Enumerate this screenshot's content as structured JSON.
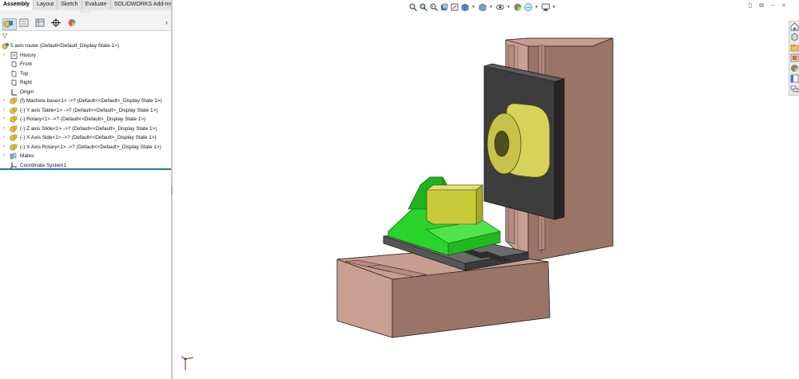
{
  "tabs": [
    "Assembly",
    "Layout",
    "Sketch",
    "Evaluate",
    "SOLIDWORKS Add-Ins"
  ],
  "manager": {
    "icons": [
      "feature-manager-icon",
      "property-manager-icon",
      "configuration-manager-icon",
      "dimxpert-manager-icon",
      "display-manager-icon"
    ],
    "expand_glyph": "›",
    "filter_glyph": "▽"
  },
  "tree": {
    "root": "5 axis router  (Default<Default_Display State-1>)",
    "items": [
      {
        "label": "History",
        "icon": "history-icon",
        "expand": true
      },
      {
        "label": "Front",
        "icon": "plane-icon",
        "expand": false
      },
      {
        "label": "Top",
        "icon": "plane-icon",
        "expand": false
      },
      {
        "label": "Right",
        "icon": "plane-icon",
        "expand": false
      },
      {
        "label": "Origin",
        "icon": "origin-icon",
        "expand": false
      },
      {
        "label": "(f) Machine base<1> ->? (Default<<Default>_Display State 1>)",
        "icon": "part-icon",
        "expand": true
      },
      {
        "label": "(-) Y axis Table<1> ->? (Default<<Default>_Display State 1>)",
        "icon": "part-icon",
        "expand": true
      },
      {
        "label": "(-) Rotary<1> ->? (Default<<Default>_Display State 1>)",
        "icon": "part-icon",
        "expand": true
      },
      {
        "label": "(-) Z axis Slide<1> ->? (Default<<Default>_Display State 1>)",
        "icon": "part-icon",
        "expand": true
      },
      {
        "label": "(-) X Axis Side<1> ->? (Default<<Default>_Display State 1>)",
        "icon": "part-icon",
        "expand": true
      },
      {
        "label": "(-) X Axis Rotary<1> ->? (Default<<Default>_Display State 1>)",
        "icon": "part-icon",
        "expand": true
      },
      {
        "label": "Mates",
        "icon": "mates-icon",
        "expand": true
      },
      {
        "label": "Coordinate System1",
        "icon": "coordinate-system-icon",
        "expand": false
      }
    ]
  },
  "heads_up_toolbar": [
    "zoom-to-fit-icon",
    "zoom-to-area-icon",
    "previous-view-icon",
    "section-view-icon",
    "dynamic-annotation-icon",
    "view-orientation-icon",
    "display-style-icon",
    "hide-show-items-icon",
    "edit-appearance-icon",
    "apply-scene-icon",
    "view-settings-icon"
  ],
  "window_controls": [
    "restore-icon",
    "tile-icon",
    "minimize-icon",
    "close-icon"
  ],
  "task_pane": [
    "solidworks-resources-icon",
    "design-library-icon",
    "file-explorer-icon",
    "view-palette-icon",
    "appearances-icon",
    "custom-properties-icon",
    "forum-icon"
  ],
  "colors": {
    "machine_base": "#9b7468",
    "machine_base_top": "#c69d8f",
    "y_table": "#4a4a4a",
    "rotary_green": "#2bd42b",
    "z_slide_yellow": "#c9c93a",
    "x_side_plate": "#3d3d3d",
    "x_rotary_yellow": "#d8d25a",
    "selection_line": "#2a6cc4"
  }
}
